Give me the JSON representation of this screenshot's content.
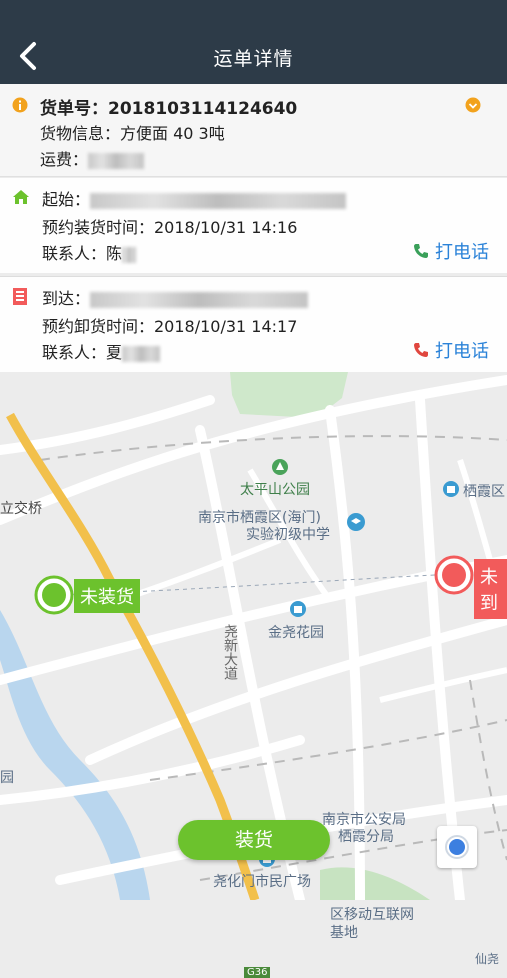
{
  "header": {
    "title": "运单详情"
  },
  "info": {
    "order_label": "货单号：",
    "order_number": "2018103114124640",
    "cargo": "货物信息：方便面 40 3吨",
    "freight_label": "运费："
  },
  "start": {
    "label": "起始：",
    "time": "预约装货时间：2018/10/31 14:16",
    "contact": "联系人：陈",
    "call": "打电话"
  },
  "end": {
    "label": "到达：",
    "time": "预约卸货时间：2018/10/31 14:17",
    "contact": "联系人：夏",
    "call": "打电话"
  },
  "map": {
    "start_status": "未装货",
    "end_status": "未到",
    "labels": {
      "park": "太平山公园",
      "school1": "南京市栖霞区(海门)",
      "school2": "实验初级中学",
      "garden": "金尧花园",
      "road": "尧新大道",
      "bridge": "立交桥",
      "district": "栖霞区",
      "police1": "南京市公安局",
      "police2": "栖霞分局",
      "plaza": "尧化门市民广场",
      "mobile1": "区移动互联网",
      "mobile2": "基地",
      "highway": "G36",
      "xianhe": "仙尧",
      "left_edge": "园"
    }
  },
  "load_button": "装货",
  "colors": {
    "header": "#2d3b48",
    "green": "#6cc22d",
    "red": "#f25b5b",
    "blue": "#2a82d8",
    "orange": "#f2a21d"
  }
}
